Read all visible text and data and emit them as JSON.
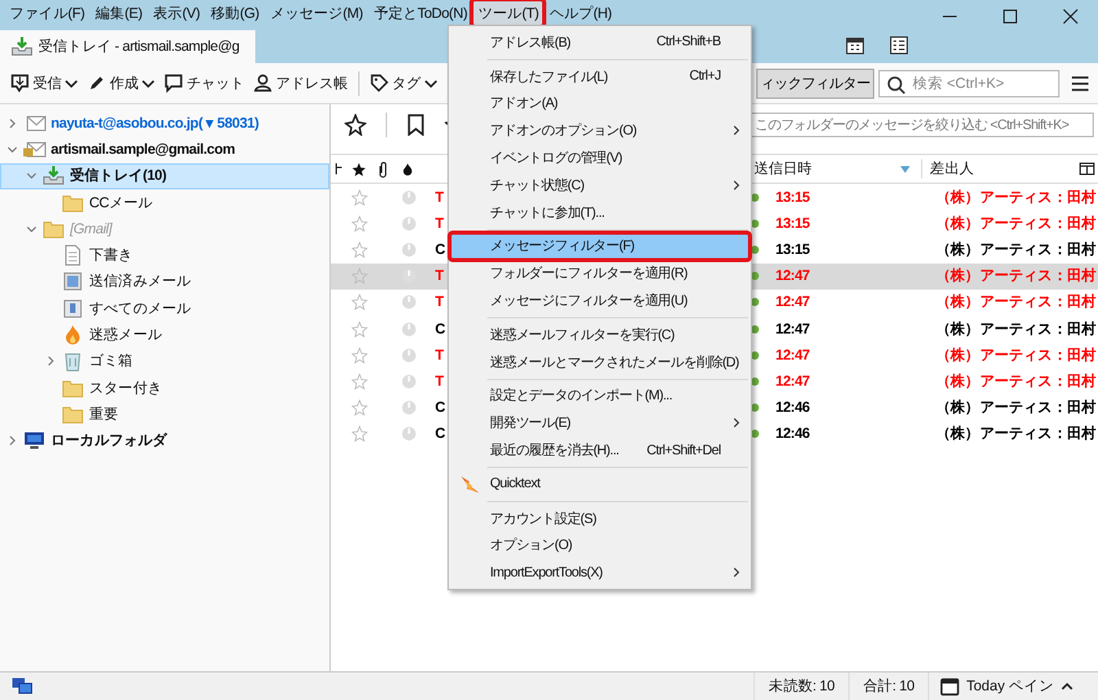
{
  "menu_bar": [
    {
      "label": "ファイル(F)",
      "selected": false,
      "marked": false
    },
    {
      "label": "編集(E)",
      "selected": false,
      "marked": false
    },
    {
      "label": "表示(V)",
      "selected": false,
      "marked": false
    },
    {
      "label": "移動(G)",
      "selected": false,
      "marked": false
    },
    {
      "label": "メッセージ(M)",
      "selected": false,
      "marked": false
    },
    {
      "label": "予定とToDo(N)",
      "selected": false,
      "marked": false
    },
    {
      "label": "ツール(T)",
      "selected": true,
      "marked": true
    },
    {
      "label": "ヘルプ(H)",
      "selected": false,
      "marked": false
    }
  ],
  "tab": {
    "title": "受信トレイ - artismail.sample@g"
  },
  "toolbar": {
    "buttons": [
      {
        "label": "受信",
        "kind": "get",
        "dropdown": true
      },
      {
        "label": "作成",
        "kind": "write",
        "dropdown": true
      },
      {
        "label": "チャット",
        "kind": "chat",
        "dropdown": false
      },
      {
        "label": "アドレス帳",
        "kind": "contacts",
        "dropdown": false
      },
      {
        "label": "タグ",
        "kind": "tag",
        "dropdown": true
      }
    ],
    "quick_filter": "ィックフィルター",
    "search": {
      "placeholder": "検索 <Ctrl+K>"
    }
  },
  "folders": [
    {
      "label": "nayuta-t@asobou.co.jp",
      "count": "( ▾ 58031)",
      "kind": "account",
      "new_mail": true,
      "expanded": false
    },
    {
      "label": "artismail.sample@gmail.com",
      "kind": "account-locked",
      "new_mail": false,
      "expanded": true,
      "children": [
        {
          "label": "受信トレイ",
          "count": "(10)",
          "kind": "inbox",
          "unread": true,
          "selected": true,
          "expanded": true,
          "children": [
            {
              "label": "CCメール",
              "kind": "folder",
              "selected": false
            }
          ]
        },
        {
          "label": "[Gmail]",
          "kind": "group",
          "selected": false,
          "expanded": true,
          "children": [
            {
              "label": "下書き",
              "kind": "drafts",
              "selected": false
            },
            {
              "label": "送信済みメール",
              "kind": "sent",
              "selected": false
            },
            {
              "label": "すべてのメール",
              "kind": "all",
              "selected": false
            },
            {
              "label": "迷惑メール",
              "kind": "junk",
              "selected": false
            },
            {
              "label": "ゴミ箱",
              "kind": "trash",
              "selected": false,
              "expanded": false
            },
            {
              "label": "スター付き",
              "kind": "folder",
              "selected": false
            },
            {
              "label": "重要",
              "kind": "folder",
              "selected": false
            }
          ]
        }
      ]
    },
    {
      "label": "ローカルフォルダ",
      "kind": "local",
      "new_mail": false,
      "expanded": false
    }
  ],
  "filter_bar": {
    "placeholder": "このフォルダーのメッセージを絞り込む <Ctrl+Shift+K>"
  },
  "message_list": {
    "columns": [
      {
        "label": "送信日時",
        "sorted": true
      },
      {
        "label": "差出人",
        "sorted": false
      }
    ],
    "rows": [
      {
        "subject": "T",
        "time": "13:15",
        "sender": "（株）アーティス：田村",
        "color": "#ff0000",
        "selected": false
      },
      {
        "subject": "T",
        "time": "13:15",
        "sender": "（株）アーティス：田村",
        "color": "#ff0000",
        "selected": false
      },
      {
        "subject": "C",
        "time": "13:15",
        "sender": "（株）アーティス：田村",
        "color": "#000000",
        "selected": false
      },
      {
        "subject": "T",
        "time": "12:47",
        "sender": "（株）アーティス：田村",
        "color": "#ff0000",
        "selected": true
      },
      {
        "subject": "T",
        "time": "12:47",
        "sender": "（株）アーティス：田村",
        "color": "#ff0000",
        "selected": false
      },
      {
        "subject": "C",
        "time": "12:47",
        "sender": "（株）アーティス：田村",
        "color": "#000000",
        "selected": false
      },
      {
        "subject": "T",
        "time": "12:47",
        "sender": "（株）アーティス：田村",
        "color": "#ff0000",
        "selected": false
      },
      {
        "subject": "T",
        "time": "12:47",
        "sender": "（株）アーティス：田村",
        "color": "#ff0000",
        "selected": false
      },
      {
        "subject": "C",
        "time": "12:46",
        "sender": "（株）アーティス：田村",
        "color": "#000000",
        "selected": false
      },
      {
        "subject": "C",
        "time": "12:46",
        "sender": "（株）アーティス：田村",
        "color": "#000000",
        "selected": false
      }
    ]
  },
  "tools_menu": {
    "items": [
      {
        "kind": "item",
        "label": "アドレス帳(B)",
        "shortcut": "Ctrl+Shift+B",
        "submenu": false,
        "selected": false,
        "marked": false
      },
      {
        "kind": "separator"
      },
      {
        "kind": "item",
        "label": "保存したファイル(L)",
        "shortcut": "Ctrl+J",
        "submenu": false,
        "selected": false,
        "marked": false
      },
      {
        "kind": "item",
        "label": "アドオン(A)",
        "submenu": false,
        "selected": false,
        "marked": false
      },
      {
        "kind": "item",
        "label": "アドオンのオプション(O)",
        "submenu": true,
        "selected": false,
        "marked": false
      },
      {
        "kind": "item",
        "label": "イベントログの管理(V)",
        "submenu": false,
        "selected": false,
        "marked": false
      },
      {
        "kind": "item",
        "label": "チャット状態(C)",
        "submenu": true,
        "selected": false,
        "marked": false
      },
      {
        "kind": "item",
        "label": "チャットに参加(T)...",
        "submenu": false,
        "selected": false,
        "marked": false
      },
      {
        "kind": "separator"
      },
      {
        "kind": "item",
        "label": "メッセージフィルター(F)",
        "submenu": false,
        "selected": true,
        "marked": true
      },
      {
        "kind": "item",
        "label": "フォルダーにフィルターを適用(R)",
        "submenu": false,
        "selected": false,
        "marked": false
      },
      {
        "kind": "item",
        "label": "メッセージにフィルターを適用(U)",
        "submenu": false,
        "selected": false,
        "marked": false
      },
      {
        "kind": "separator"
      },
      {
        "kind": "item",
        "label": "迷惑メールフィルターを実行(C)",
        "submenu": false,
        "selected": false,
        "marked": false
      },
      {
        "kind": "item",
        "label": "迷惑メールとマークされたメールを削除(D)",
        "submenu": false,
        "selected": false,
        "marked": false
      },
      {
        "kind": "separator"
      },
      {
        "kind": "item",
        "label": "設定とデータのインポート(M)...",
        "submenu": false,
        "selected": false,
        "marked": false
      },
      {
        "kind": "item",
        "label": "開発ツール(E)",
        "submenu": true,
        "selected": false,
        "marked": false
      },
      {
        "kind": "item",
        "label": "最近の履歴を消去(H)...",
        "shortcut": "Ctrl+Shift+Del",
        "submenu": false,
        "selected": false,
        "marked": false
      },
      {
        "kind": "separator"
      },
      {
        "kind": "plugin",
        "label": "Quicktext",
        "submenu": false,
        "selected": false,
        "marked": false
      },
      {
        "kind": "separator"
      },
      {
        "kind": "item",
        "label": "アカウント設定(S)",
        "submenu": false,
        "selected": false,
        "marked": false
      },
      {
        "kind": "item",
        "label": "オプション(O)",
        "submenu": false,
        "selected": false,
        "marked": false
      },
      {
        "kind": "item",
        "label": "ImportExportTools(X)",
        "submenu": true,
        "selected": false,
        "marked": false
      }
    ]
  },
  "status_bar": {
    "unread": "未読数: 10",
    "total": "合計: 10",
    "today_pane": "Today ペイン"
  }
}
